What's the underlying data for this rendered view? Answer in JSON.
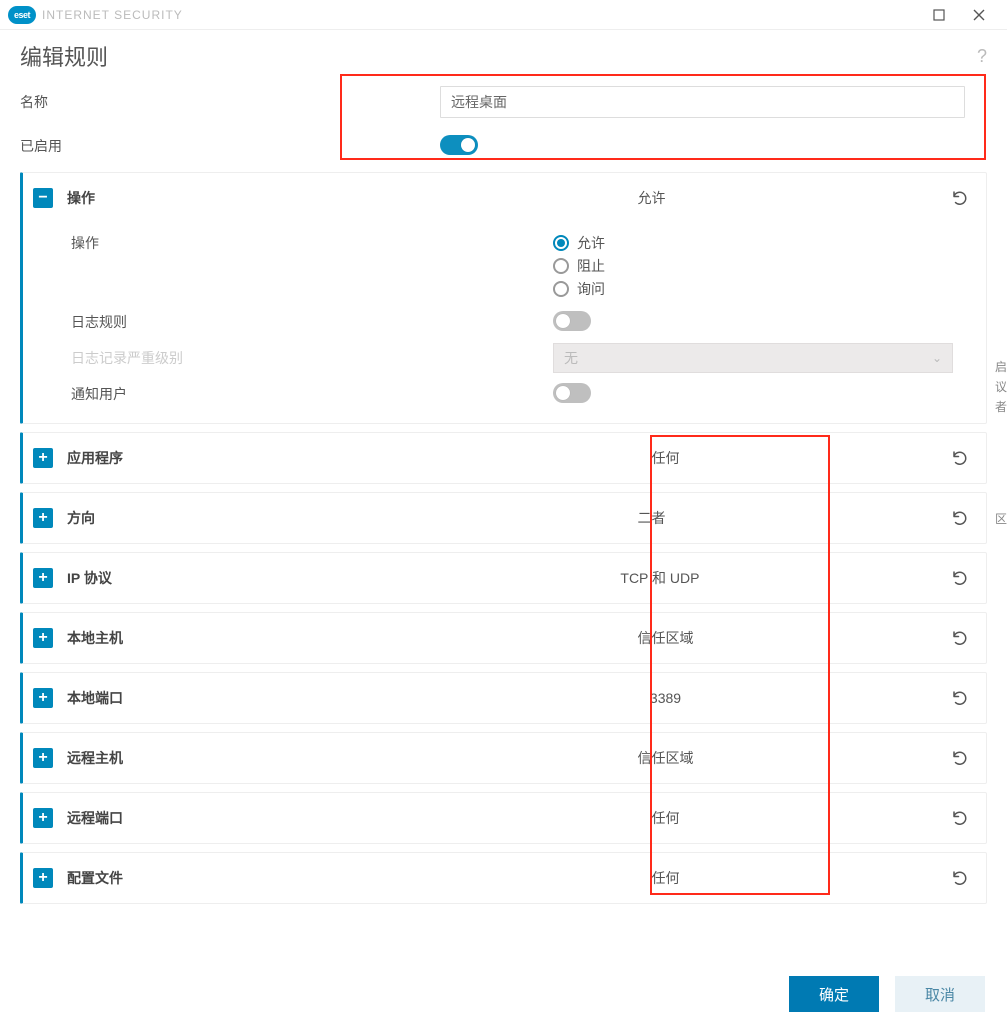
{
  "titlebar": {
    "product": "INTERNET SECURITY",
    "logo_text": "eset"
  },
  "header": {
    "title": "编辑规则",
    "help": "?"
  },
  "form": {
    "name_label": "名称",
    "name_value": "远程桌面",
    "enabled_label": "已启用",
    "enabled": true
  },
  "action_section": {
    "label": "操作",
    "summary": "允许",
    "action_sub_label": "操作",
    "radios": {
      "allow": "允许",
      "block": "阻止",
      "ask": "询问"
    },
    "selected_radio": "allow",
    "log_rule_label": "日志规则",
    "log_rule_on": false,
    "severity_label": "日志记录严重级别",
    "severity_value": "无",
    "notify_label": "通知用户",
    "notify_on": false
  },
  "sections": [
    {
      "key": "application",
      "label": "应用程序",
      "value": "任何"
    },
    {
      "key": "direction",
      "label": "方向",
      "value": "二者"
    },
    {
      "key": "ip_protocol",
      "label": "IP 协议",
      "value": "TCP 和 UDP"
    },
    {
      "key": "local_host",
      "label": "本地主机",
      "value": "信任区域"
    },
    {
      "key": "local_port",
      "label": "本地端口",
      "value": "3389"
    },
    {
      "key": "remote_host",
      "label": "远程主机",
      "value": "信任区域"
    },
    {
      "key": "remote_port",
      "label": "远程端口",
      "value": "任何"
    },
    {
      "key": "profile",
      "label": "配置文件",
      "value": "任何"
    }
  ],
  "footer": {
    "ok": "确定",
    "cancel": "取消"
  },
  "edge_text": {
    "a": "启",
    "b": "议",
    "c": "者",
    "d": "区"
  }
}
